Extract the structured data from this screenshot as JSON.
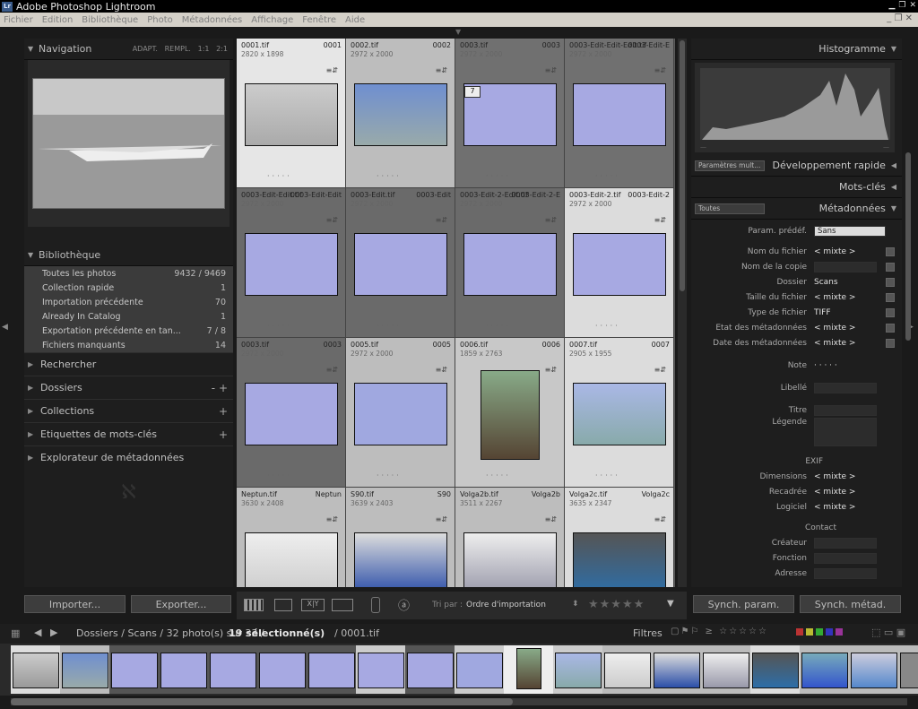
{
  "app": {
    "title": "Adobe Photoshop Lightroom",
    "logo": "Lr"
  },
  "menu": [
    "Fichier",
    "Edition",
    "Bibliothèque",
    "Photo",
    "Métadonnées",
    "Affichage",
    "Fenêtre",
    "Aide"
  ],
  "navigation": {
    "title": "Navigation",
    "options": [
      "ADAPT.",
      "REMPL.",
      "1:1",
      "2:1"
    ]
  },
  "library": {
    "title": "Bibliothèque",
    "items": [
      {
        "label": "Toutes les photos",
        "count": "9432 / 9469"
      },
      {
        "label": "Collection rapide",
        "count": "1"
      },
      {
        "label": "Importation précédente",
        "count": "70"
      },
      {
        "label": "Already In Catalog",
        "count": "1"
      },
      {
        "label": "Exportation précédente en tan...",
        "count": "7 / 8"
      },
      {
        "label": "Fichiers manquants",
        "count": "14"
      }
    ]
  },
  "collapsed_panels": [
    {
      "label": "Rechercher",
      "control": ""
    },
    {
      "label": "Dossiers",
      "control": "- +"
    },
    {
      "label": "Collections",
      "control": "+"
    },
    {
      "label": "Etiquettes de mots-clés",
      "control": "+"
    },
    {
      "label": "Explorateur de métadonnées",
      "control": ""
    }
  ],
  "grid": [
    {
      "name": "0001.tif",
      "idx": "0001",
      "dim": "2820 x 1898"
    },
    {
      "name": "0002.tif",
      "idx": "0002",
      "dim": "2972 x 2000"
    },
    {
      "name": "0003.tif",
      "idx": "0003",
      "dim": "2972 x 2000"
    },
    {
      "name": "0003-Edit-Edit-Edit.tif",
      "idx": "0003-Edit-E",
      "dim": "2972 x 2000"
    },
    {
      "name": "0003-Edit-Edit.tif",
      "idx": "0003-Edit-Edit",
      "dim": "2972 x 2000"
    },
    {
      "name": "0003-Edit.tif",
      "idx": "0003-Edit",
      "dim": "2972 x 2000"
    },
    {
      "name": "0003-Edit-2-Edit.tif",
      "idx": "0003-Edit-2-E",
      "dim": "2972 x 2000"
    },
    {
      "name": "0003-Edit-2.tif",
      "idx": "0003-Edit-2",
      "dim": "2972 x 2000"
    },
    {
      "name": "0003.tif",
      "idx": "0003",
      "dim": "2972 x 2000"
    },
    {
      "name": "0005.tif",
      "idx": "0005",
      "dim": "2972 x 2000"
    },
    {
      "name": "0006.tif",
      "idx": "0006",
      "dim": "1859 x 2763"
    },
    {
      "name": "0007.tif",
      "idx": "0007",
      "dim": "2905 x 1955"
    },
    {
      "name": "Neptun.tif",
      "idx": "Neptun",
      "dim": "3630 x 2408"
    },
    {
      "name": "S90.tif",
      "idx": "S90",
      "dim": "3639 x 2403"
    },
    {
      "name": "Volga2b.tif",
      "idx": "Volga2b",
      "dim": "3511 x 2267"
    },
    {
      "name": "Volga2c.tif",
      "idx": "Volga2c",
      "dim": "3635 x 2347"
    }
  ],
  "stack_badge": "7",
  "histogram": {
    "title": "Histogramme"
  },
  "quick_dev": {
    "title": "Développement rapide",
    "preset": "Paramètres mult..."
  },
  "keywords": {
    "title": "Mots-clés"
  },
  "metadata": {
    "title": "Métadonnées",
    "set": "Toutes",
    "preset_label": "Param. prédéf.",
    "preset_value": "Sans",
    "rows": [
      {
        "label": "Nom du fichier",
        "value": "< mixte >"
      },
      {
        "label": "Nom de la copie",
        "value": ""
      },
      {
        "label": "Dossier",
        "value": "Scans"
      },
      {
        "label": "Taille du fichier",
        "value": "< mixte >"
      },
      {
        "label": "Type de fichier",
        "value": "TIFF"
      },
      {
        "label": "Etat des métadonnées",
        "value": "< mixte >"
      },
      {
        "label": "Date des métadonnées",
        "value": "< mixte >"
      }
    ],
    "note_label": "Note",
    "note_value": "· · · · ·",
    "libelle": "Libellé",
    "titre": "Titre",
    "legende": "Légende",
    "exif": "EXIF",
    "exif_rows": [
      {
        "label": "Dimensions",
        "value": "< mixte >"
      },
      {
        "label": "Recadrée",
        "value": "< mixte >"
      },
      {
        "label": "Logiciel",
        "value": "< mixte >"
      }
    ],
    "contact": "Contact",
    "contact_rows": [
      "Créateur",
      "Fonction",
      "Adresse"
    ]
  },
  "buttons": {
    "import": "Importer...",
    "export": "Exporter...",
    "sync_settings": "Synch. param.",
    "sync_meta": "Synch. métad."
  },
  "toolbar": {
    "sort_label": "Tri par :",
    "sort_value": "Ordre d'importation",
    "xy": "X|Y"
  },
  "filmstrip_bar": {
    "path": "Dossiers / Scans / 32 photo(s) sur 33 /",
    "selected": "19 sélectionné(s)",
    "file": "/ 0001.tif",
    "filters": "Filtres"
  }
}
